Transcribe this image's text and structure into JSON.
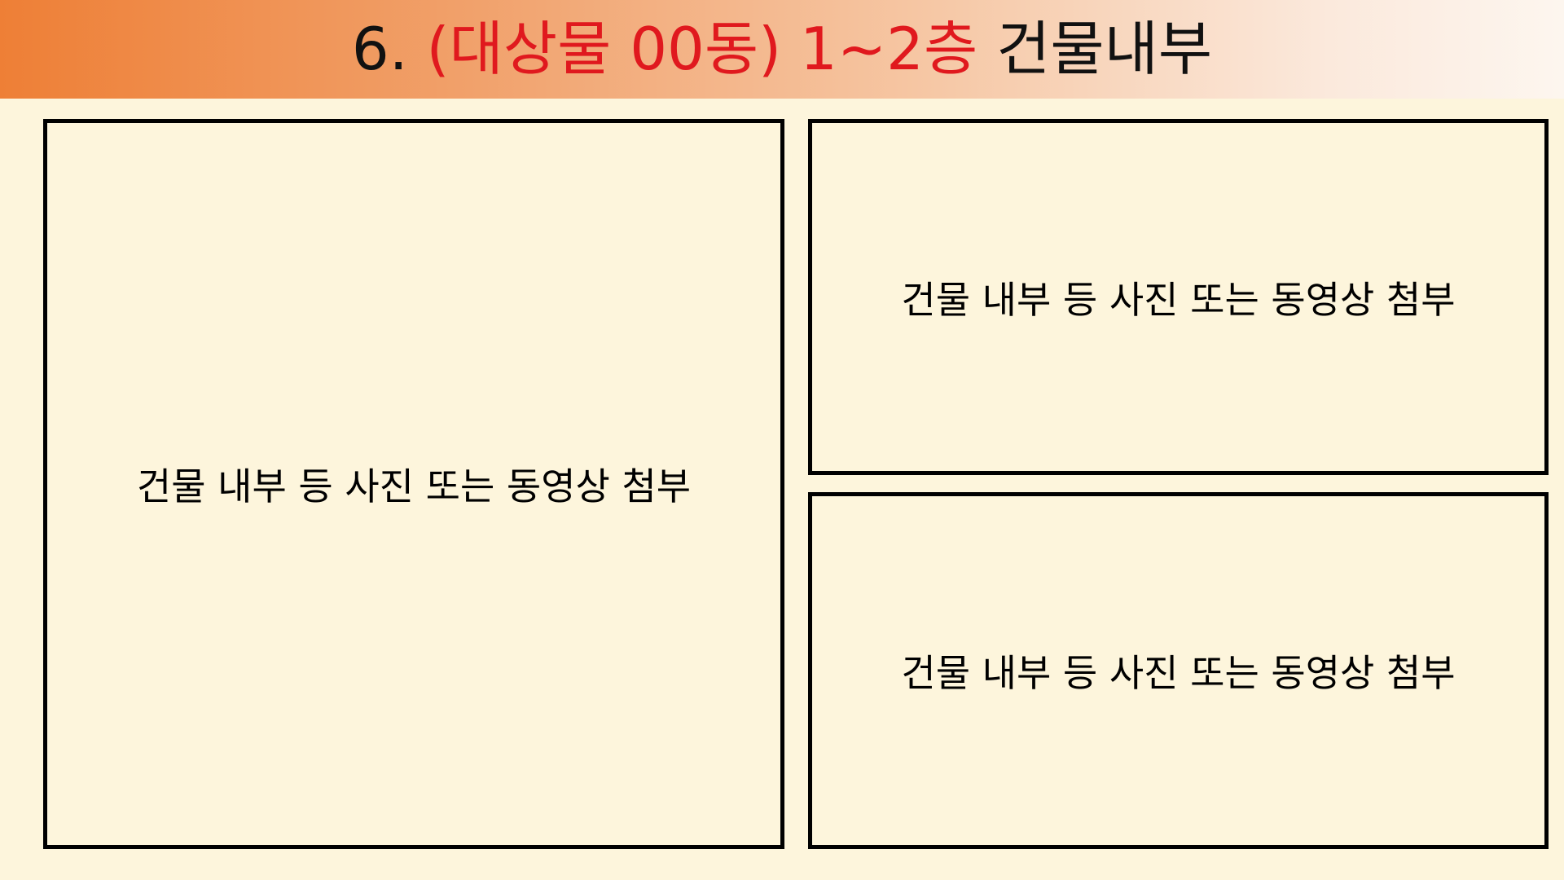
{
  "slide": {
    "title": {
      "number_prefix": "6. ",
      "highlighted_part": "(대상물 00동) 1~2층",
      "suffix": " 건물내부"
    },
    "panels": [
      {
        "caption": "건물 내부 등 사진 또는 동영상 첨부"
      },
      {
        "caption": "건물 내부 등 사진 또는 동영상 첨부"
      },
      {
        "caption": "건물 내부 등 사진 또는 동영상 첨부"
      }
    ]
  },
  "colors": {
    "title_gradient_start": "#ee7f36",
    "title_gradient_end": "#fdf6ef",
    "background": "#fdf5dc",
    "highlight_red": "#e0191e",
    "border": "#000000"
  }
}
